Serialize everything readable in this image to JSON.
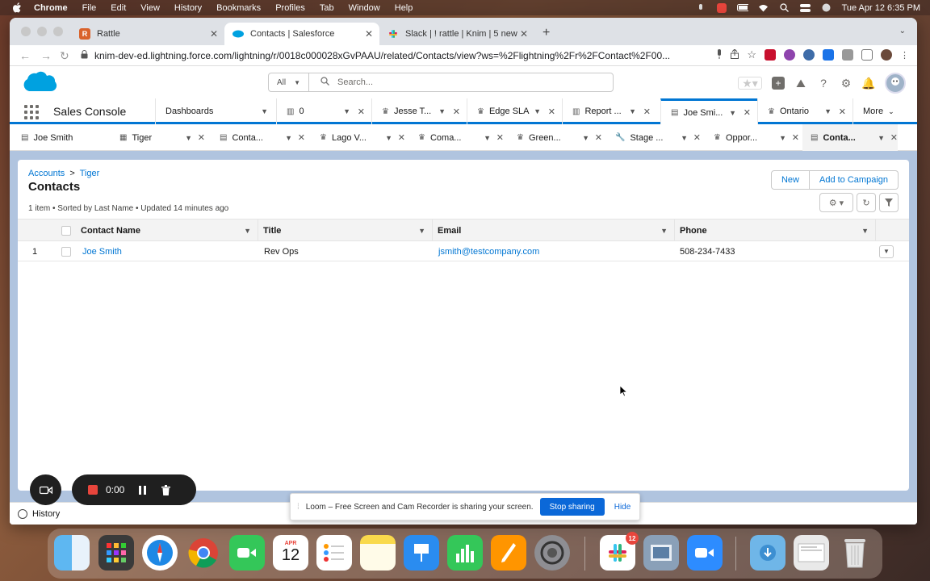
{
  "menubar": {
    "items": [
      "Chrome",
      "File",
      "Edit",
      "View",
      "History",
      "Bookmarks",
      "Profiles",
      "Tab",
      "Window",
      "Help"
    ],
    "clock": "Tue Apr 12  6:35 PM"
  },
  "browser": {
    "tabs": [
      {
        "title": "Rattle",
        "favicon": "R"
      },
      {
        "title": "Contacts | Salesforce",
        "favicon": "salesforce-cloud"
      },
      {
        "title": "Slack | ! rattle | Knim | 5 new ite",
        "favicon": "slack"
      }
    ],
    "url": "knim-dev-ed.lightning.force.com/lightning/r/0018c000028xGvPAAU/related/Contacts/view?ws=%2Flightning%2Fr%2FContact%2F00..."
  },
  "sf_header": {
    "search_scope": "All",
    "search_placeholder": "Search..."
  },
  "nav": {
    "app_name": "Sales Console",
    "tabs": [
      {
        "label": "Dashboards"
      },
      {
        "label": "0"
      },
      {
        "label": "Jesse T..."
      },
      {
        "label": "Edge SLA"
      },
      {
        "label": "Report ..."
      },
      {
        "label": "Joe Smi..."
      },
      {
        "label": "Ontario"
      }
    ],
    "more": "More"
  },
  "subtabs": [
    {
      "label": "Joe Smith"
    },
    {
      "label": "Tiger"
    },
    {
      "label": "Conta..."
    },
    {
      "label": "Lago V..."
    },
    {
      "label": "Coma..."
    },
    {
      "label": "Green..."
    },
    {
      "label": "Stage ..."
    },
    {
      "label": "Oppor..."
    },
    {
      "label": "Conta..."
    }
  ],
  "page": {
    "breadcrumb": {
      "parent": "Accounts",
      "sep": ">",
      "record": "Tiger"
    },
    "title": "Contacts",
    "meta": "1 item • Sorted by Last Name • Updated 14 minutes ago",
    "buttons": {
      "new": "New",
      "add_to_campaign": "Add to Campaign"
    }
  },
  "table": {
    "columns": [
      "Contact Name",
      "Title",
      "Email",
      "Phone"
    ],
    "rows": [
      {
        "num": "1",
        "name": "Joe Smith",
        "title": "Rev Ops",
        "email": "jsmith@testcompany.com",
        "phone": "508-234-7433"
      }
    ]
  },
  "footer": {
    "history": "History"
  },
  "loom": {
    "timer": "0:00",
    "message": "Loom – Free Screen and Cam Recorder is sharing your screen.",
    "stop": "Stop sharing",
    "hide": "Hide"
  },
  "dock": {
    "calendar_month": "APR",
    "calendar_day": "12",
    "slack_badge": "12"
  },
  "colors": {
    "sf_blue": "#0176d3",
    "content_bg": "#b0c4df",
    "loom_blue": "#0b68d8"
  }
}
